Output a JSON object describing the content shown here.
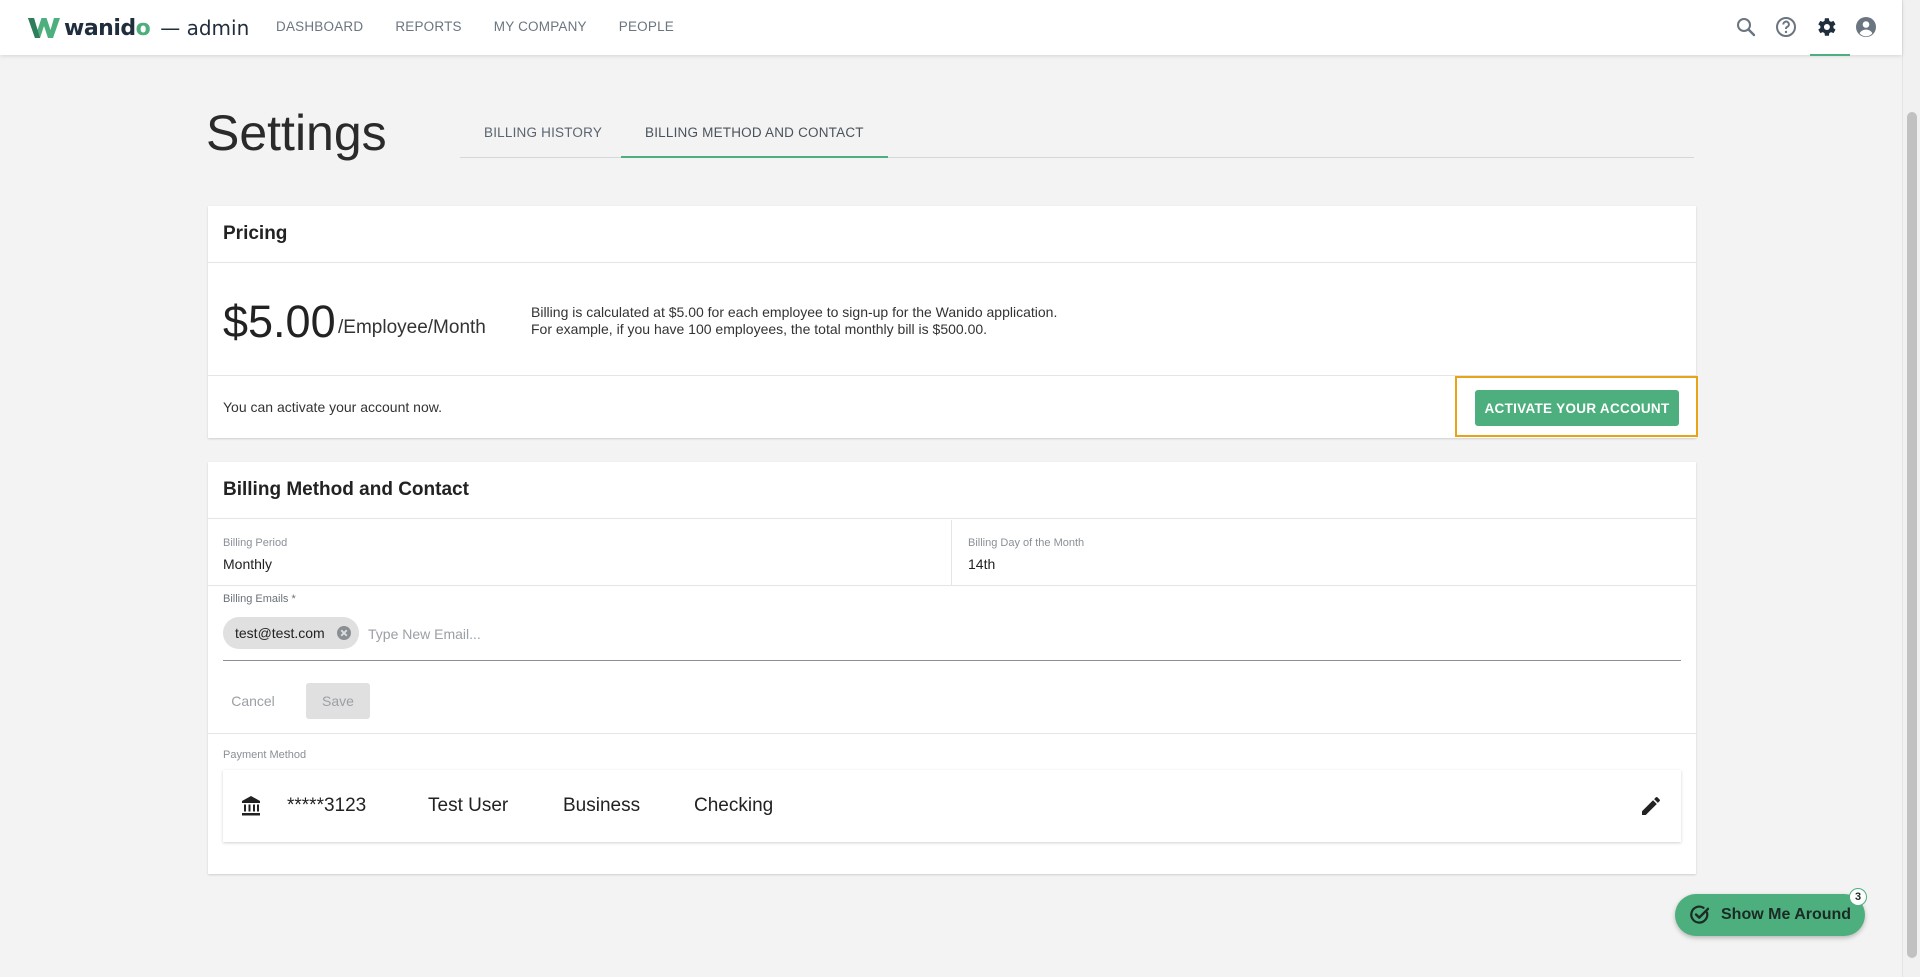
{
  "header": {
    "brand_prefix": "wanid",
    "brand_suffix": "o",
    "subtitle": "— admin",
    "nav": [
      "DASHBOARD",
      "REPORTS",
      "MY COMPANY",
      "PEOPLE"
    ],
    "icons": [
      "search-icon",
      "help-icon",
      "settings-icon",
      "account-icon"
    ],
    "active_icon": "settings-icon"
  },
  "page": {
    "title": "Settings",
    "tabs": [
      "BILLING HISTORY",
      "BILLING METHOD AND CONTACT"
    ],
    "active_tab": "BILLING METHOD AND CONTACT"
  },
  "pricing": {
    "heading": "Pricing",
    "price": "$5.00",
    "unit": "/Employee/Month",
    "desc_line1": "Billing is calculated at $5.00 for each employee to sign-up for the Wanido application.",
    "desc_line2": "For example, if you have 100 employees, the total monthly bill is $500.00.",
    "activate_text": "You can activate your account now.",
    "activate_button": "ACTIVATE YOUR ACCOUNT"
  },
  "billing": {
    "heading": "Billing Method and Contact",
    "period_label": "Billing Period",
    "period_value": "Monthly",
    "day_label": "Billing Day of the Month",
    "day_value": "14th",
    "emails_label": "Billing Emails *",
    "emails": [
      "test@test.com"
    ],
    "email_placeholder": "Type New Email...",
    "cancel_label": "Cancel",
    "save_label": "Save",
    "payment_label": "Payment Method",
    "payment": {
      "account": "*****3123",
      "name": "Test User",
      "type": "Business",
      "kind": "Checking"
    }
  },
  "tour": {
    "label": "Show Me Around",
    "badge": "3"
  },
  "colors": {
    "accent": "#4caf7d",
    "focus": "#e8a317",
    "background": "#f2f3f2"
  }
}
